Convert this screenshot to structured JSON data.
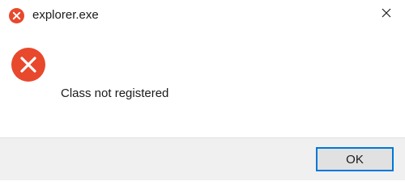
{
  "window": {
    "title": "explorer.exe",
    "title_icon": "error-icon",
    "close_icon": "close-icon"
  },
  "dialog": {
    "icon": "error-icon",
    "message": "Class not registered"
  },
  "buttons": {
    "ok_label": "OK"
  },
  "colors": {
    "error_red": "#e8482c",
    "accent": "#0078d7",
    "footer_bg": "#f0f0f0",
    "button_bg": "#e1e1e1"
  }
}
